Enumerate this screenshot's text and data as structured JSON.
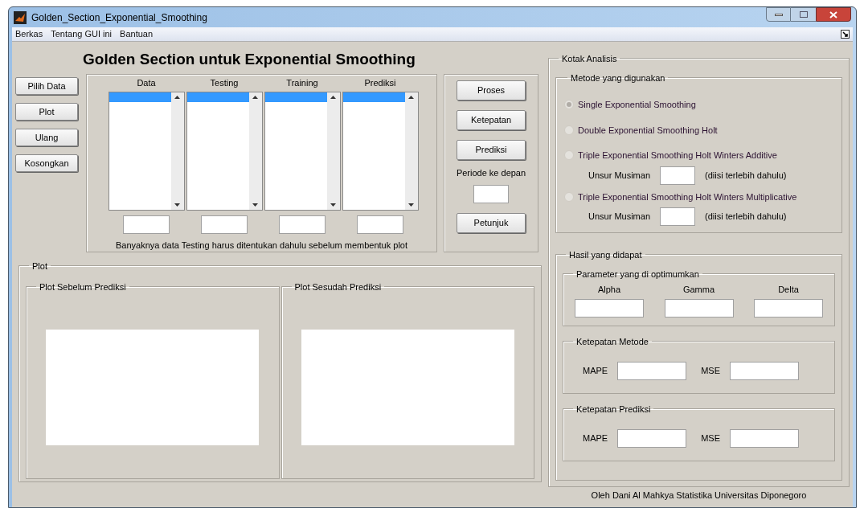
{
  "window": {
    "title": "Golden_Section_Exponential_Smoothing"
  },
  "menu": [
    "Berkas",
    "Tentang GUI ini",
    "Bantuan"
  ],
  "heading": "Golden Section untuk Exponential Smoothing",
  "side_buttons": [
    "Pilih Data",
    "Plot",
    "Ulang",
    "Kosongkan"
  ],
  "lists": [
    {
      "header": "Data",
      "rows": [
        {
          "selected": true
        }
      ]
    },
    {
      "header": "Testing",
      "rows": [
        {
          "selected": true
        }
      ]
    },
    {
      "header": "Training",
      "rows": [
        {
          "selected": true
        }
      ]
    },
    {
      "header": "Prediksi",
      "rows": [
        {
          "selected": true
        }
      ]
    }
  ],
  "list_note": "Banyaknya data Testing harus ditentukan dahulu sebelum membentuk plot",
  "actions": {
    "buttons": [
      "Proses",
      "Ketepatan",
      "Prediksi"
    ],
    "period_label": "Periode ke depan",
    "help_button": "Petunjuk"
  },
  "plot": {
    "title": "Plot",
    "panels": [
      "Plot Sebelum Prediksi",
      "Plot Sesudah Prediksi"
    ]
  },
  "analysis": {
    "title": "Kotak Analisis",
    "methods": {
      "title": "Metode yang digunakan",
      "options": [
        {
          "label": "Single Exponential Smoothing",
          "selected": true
        },
        {
          "label": "Double Exponential Smoothing Holt",
          "selected": false
        },
        {
          "label": "Triple Exponential Smoothing Holt Winters Additive",
          "selected": false,
          "season_label": "Unsur Musiman",
          "season_note": "(diisi terlebih dahulu)"
        },
        {
          "label": "Triple Exponential Smoothing Holt Winters Multiplicative",
          "selected": false,
          "season_label": "Unsur Musiman",
          "season_note": "(diisi terlebih dahulu)"
        }
      ]
    },
    "results": {
      "title": "Hasil yang didapat",
      "parameters": {
        "title": "Parameter yang di optimumkan",
        "labels": [
          "Alpha",
          "Gamma",
          "Delta"
        ]
      },
      "accuracy": [
        {
          "title": "Ketepatan Metode",
          "labels": [
            "MAPE",
            "MSE"
          ]
        },
        {
          "title": "Ketepatan Prediksi",
          "labels": [
            "MAPE",
            "MSE"
          ]
        }
      ]
    }
  },
  "footer": "Oleh Dani Al Mahkya Statistika Universitas Diponegoro"
}
